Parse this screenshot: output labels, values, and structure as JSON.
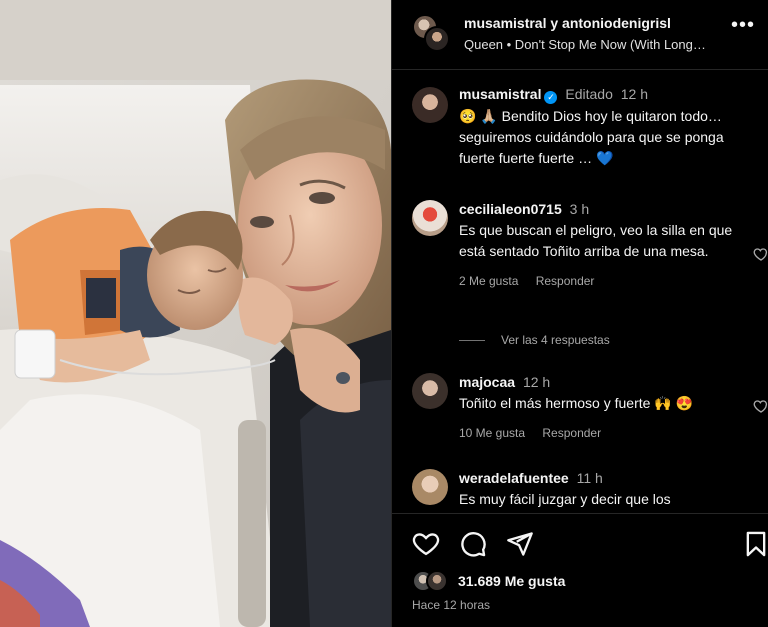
{
  "header": {
    "authors": "musamistral y antoniodenigrisl",
    "song": "Queen • Don't Stop Me Now (With Long…",
    "more_icon": "more-horizontal-icon"
  },
  "comments": [
    {
      "user": "musamistral",
      "verified": true,
      "edited": "Editado",
      "time": "12 h",
      "text": "🥺 🙏🏼 Bendito Dios hoy le quitaron todo… seguiremos cuidándolo para que se ponga fuerte fuerte fuerte … 💙"
    },
    {
      "user": "cecilialeon0715",
      "time": "3 h",
      "text": "Es que buscan el peligro, veo la silla en que está sentado Toñito arriba de una mesa.",
      "likes": "2 Me gusta",
      "reply": "Responder",
      "view_replies": "Ver las 4 respuestas"
    },
    {
      "user": "majocaa",
      "time": "12 h",
      "text": "Toñito el más hermoso y fuerte 🙌 😍",
      "likes": "10 Me gusta",
      "reply": "Responder"
    },
    {
      "user": "weradelafuentee",
      "time": "11 h",
      "text": "Es muy fácil juzgar y decir que los"
    }
  ],
  "actions": {
    "like_icon": "heart-icon",
    "comment_icon": "comment-icon",
    "share_icon": "send-icon",
    "save_icon": "bookmark-icon",
    "likes_count": "31.689 Me gusta",
    "time_ago": "Hace 12 horas"
  },
  "colors": {
    "background": "#000000",
    "muted_text": "#a8a8a8",
    "verified_blue": "#0095f6",
    "divider": "#262626"
  }
}
